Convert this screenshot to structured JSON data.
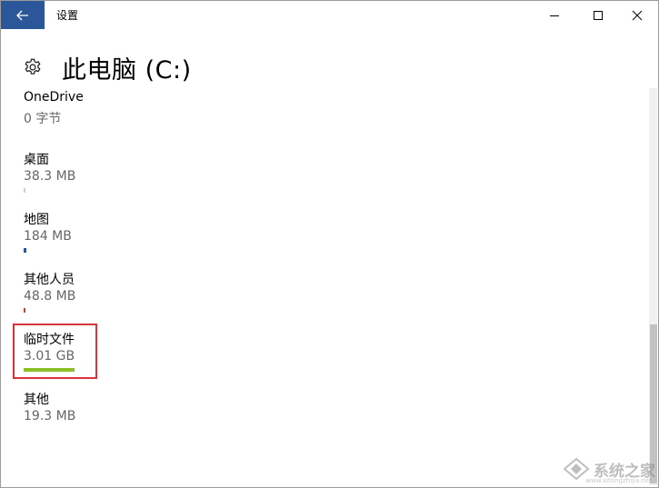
{
  "window": {
    "title": "设置",
    "back_icon": "arrow-left-icon",
    "minimize_icon": "minimize-icon",
    "maximize_icon": "maximize-icon",
    "close_icon": "close-icon"
  },
  "page": {
    "icon": "gear-icon",
    "title": "此电脑 (C:)"
  },
  "storage_items": [
    {
      "name": "OneDrive",
      "size": "0 字节",
      "usage_fraction": 0.0,
      "color": "#c8c8c8"
    },
    {
      "name": "桌面",
      "size": "38.3 MB",
      "usage_fraction": 0.02,
      "color": "#d0d0d0"
    },
    {
      "name": "地图",
      "size": "184 MB",
      "usage_fraction": 0.05,
      "color": "#2b579a"
    },
    {
      "name": "其他人员",
      "size": "48.8 MB",
      "usage_fraction": 0.02,
      "color": "#d9343b"
    },
    {
      "name": "临时文件",
      "size": "3.01 GB",
      "usage_fraction": 1.0,
      "color": "#8cbf26"
    },
    {
      "name": "其他",
      "size": "19.3 MB",
      "usage_fraction": 0.0,
      "color": "#c8c8c8"
    }
  ],
  "watermark": {
    "text": "系统之家",
    "sub": "www.xitongzhijia.net"
  },
  "colors": {
    "accent": "#2b579a",
    "highlight_border": "#d9343b"
  }
}
